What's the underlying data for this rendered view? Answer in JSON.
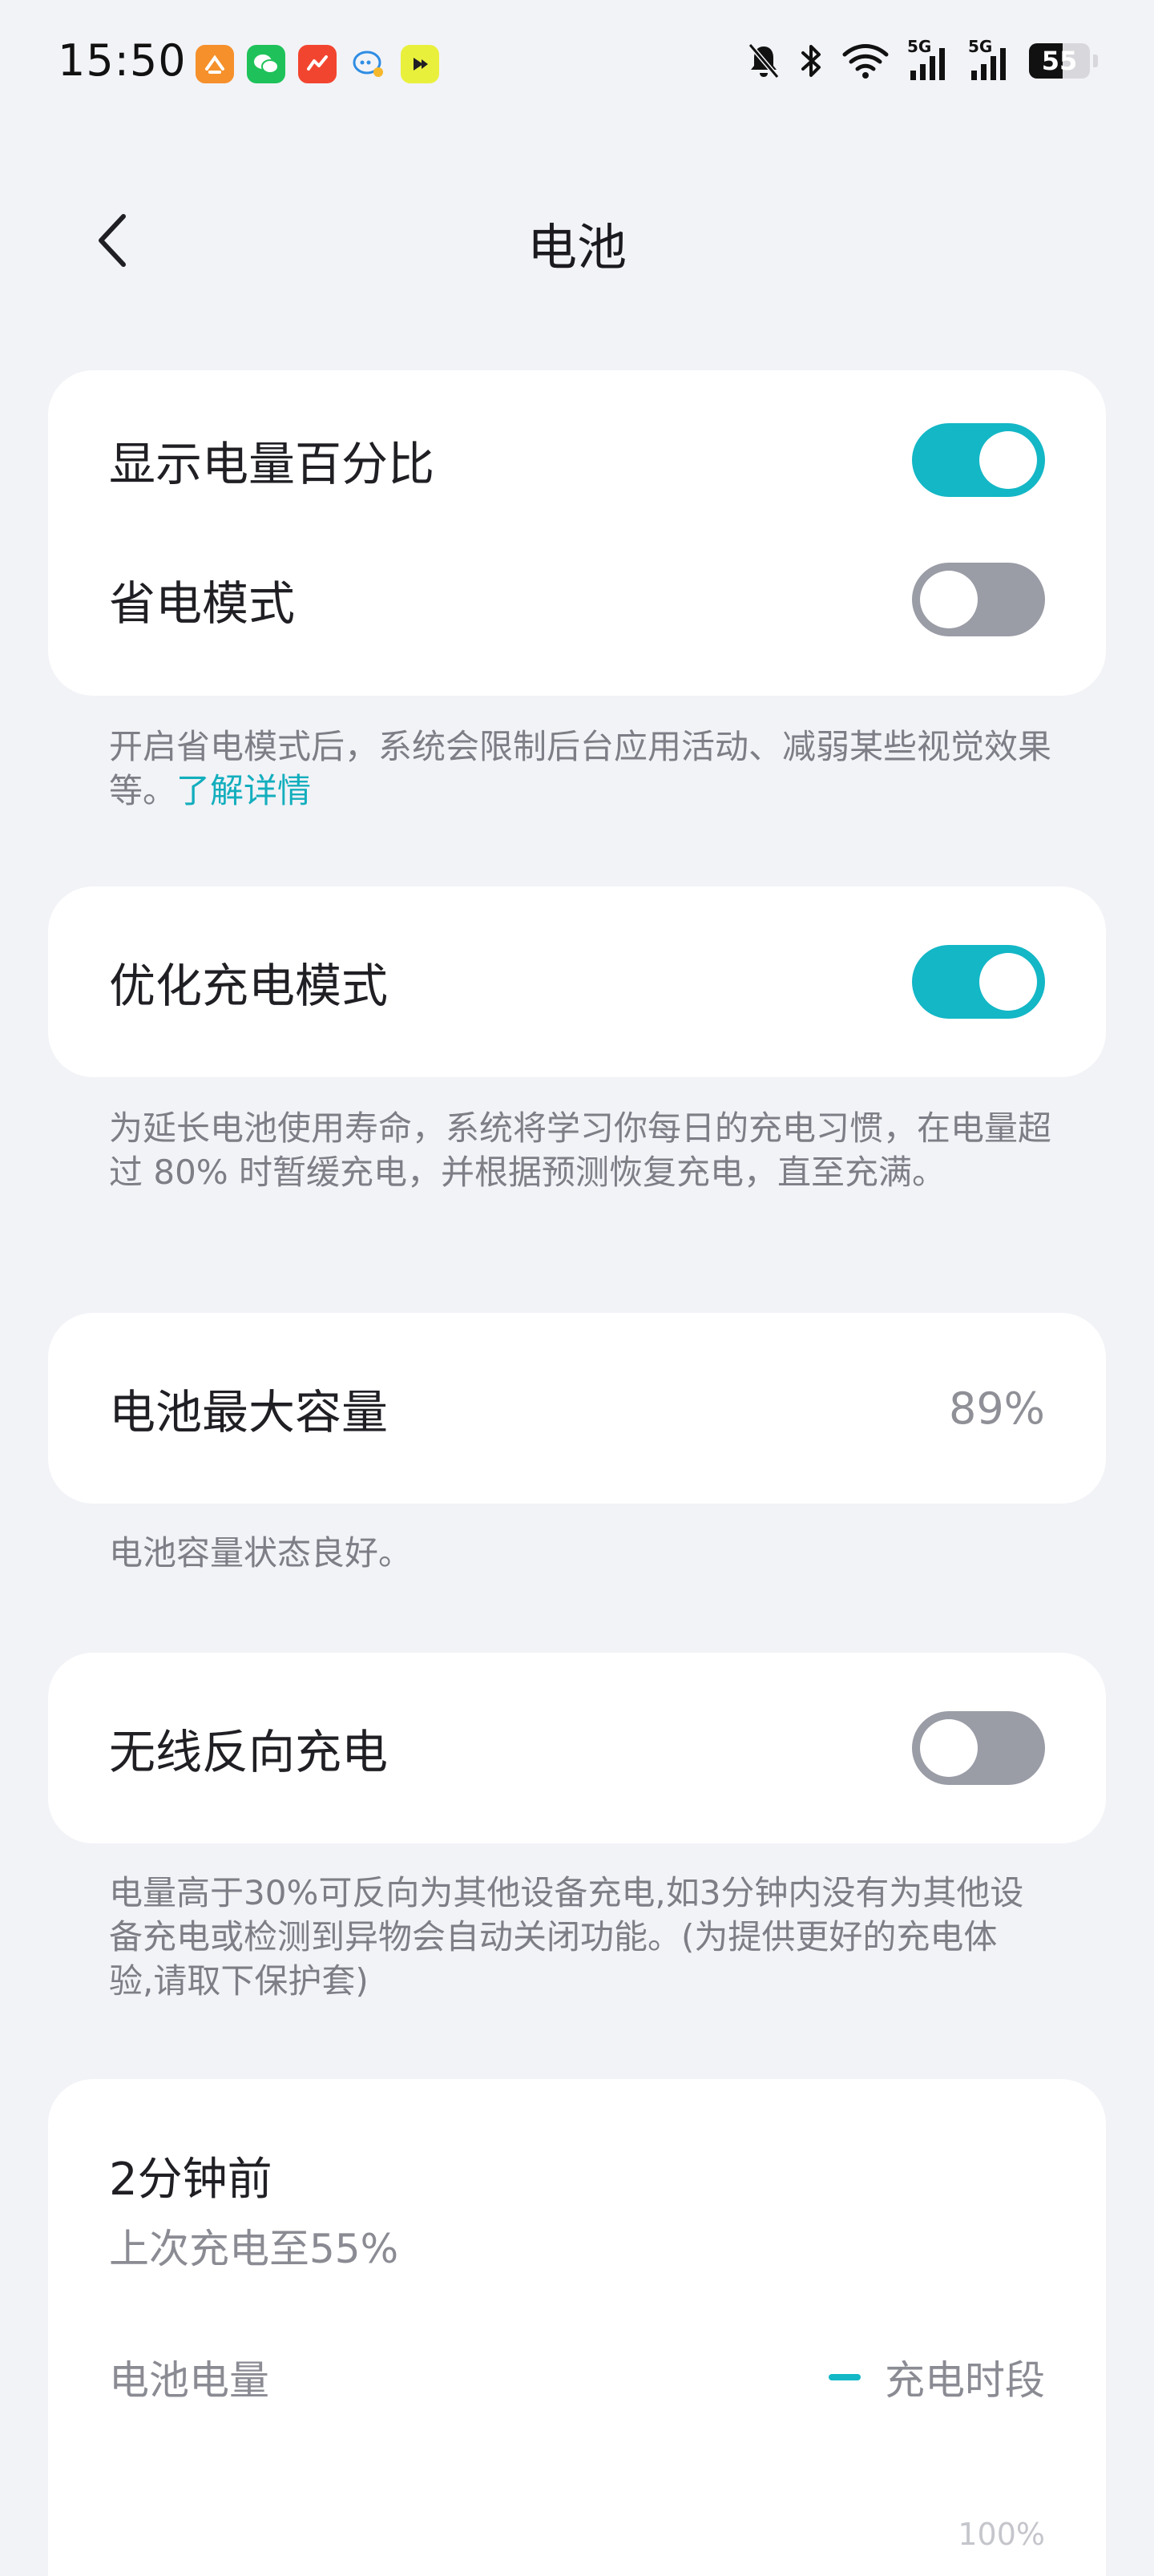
{
  "status_bar": {
    "time": "15:50",
    "signal_labels": [
      "5G",
      "5G"
    ],
    "battery": "55",
    "battery_level": 0.55,
    "icons": [
      "notifications-off-icon",
      "bluetooth-icon",
      "wifi-icon",
      "signal-icon",
      "signal-icon",
      "battery-icon"
    ],
    "app_icons": [
      "app-orange-icon",
      "wechat-icon",
      "app-red-icon",
      "app-chat-icon",
      "app-yellow-icon"
    ]
  },
  "header": {
    "title": "电池",
    "back_icon": "chevron-left-icon"
  },
  "display_card": {
    "show_percentage_label": "显示电量百分比",
    "show_percentage_on": true,
    "power_saving_label": "省电模式",
    "power_saving_on": false
  },
  "power_saving_desc": {
    "text": "开启省电模式后，系统会限制后台应用活动、减弱某些视觉效果等。",
    "link": "了解详情"
  },
  "optimized_card": {
    "label": "优化充电模式",
    "on": true
  },
  "optimized_desc": "为延长电池使用寿命，系统将学习你每日的充电习惯，在电量超过 80% 时暂缓充电，并根据预测恢复充电，直至充满。",
  "capacity_card": {
    "label": "电池最大容量",
    "value": "89%"
  },
  "capacity_desc": "电池容量状态良好。",
  "wireless_card": {
    "label": "无线反向充电",
    "on": false
  },
  "wireless_desc": "电量高于30%可反向为其他设备充电,如3分钟内没有为其他设备充电或检测到异物会自动关闭功能。(为提供更好的充电体验,请取下保护套)",
  "history_card": {
    "time_ago": "2分钟前",
    "last_charge": "上次充电至55%",
    "chart_label": "电池电量",
    "legend": "充电时段",
    "y_tick": "100%",
    "accent": "#13b7c6"
  },
  "colors": {
    "background": "#f2f3f7",
    "card": "#ffffff",
    "accent": "#13b7c6",
    "toggle_off": "#9a9ca6"
  }
}
